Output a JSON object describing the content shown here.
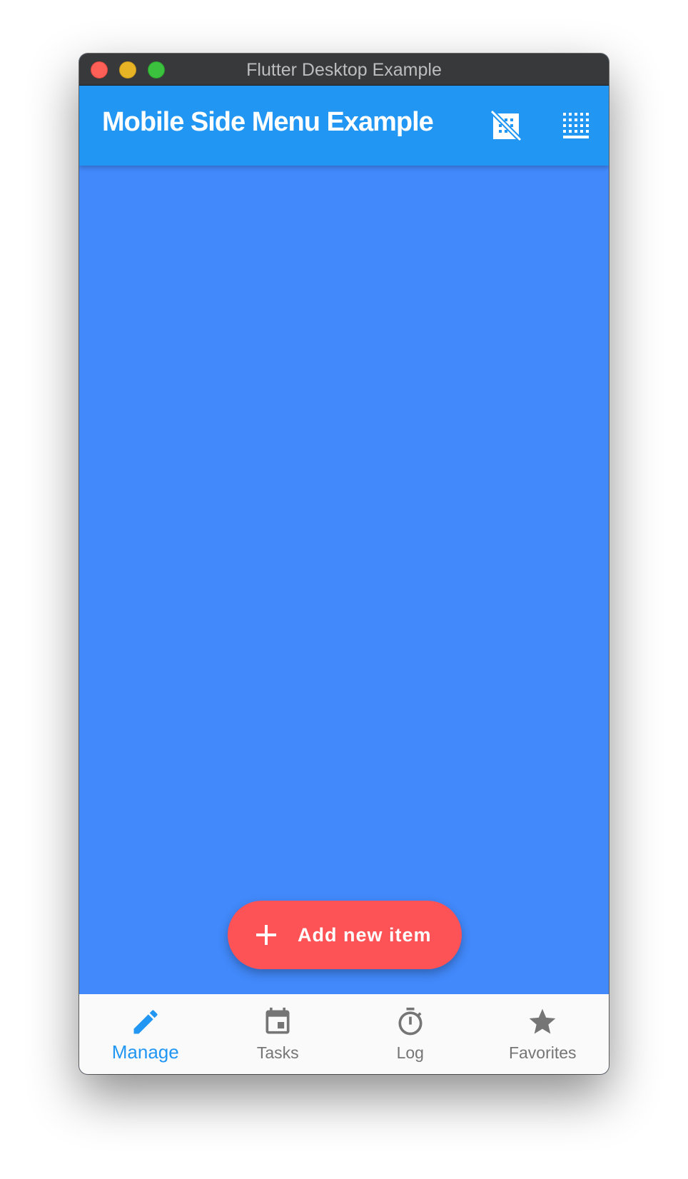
{
  "window": {
    "title": "Flutter Desktop Example"
  },
  "appbar": {
    "title": "Mobile Side Menu Example",
    "actions": [
      {
        "icon": "grid-off-icon"
      },
      {
        "icon": "grid-dots-icon"
      }
    ]
  },
  "fab": {
    "icon": "add-icon",
    "label": "Add new item"
  },
  "bottom_nav": {
    "items": [
      {
        "label": "Manage",
        "icon": "pencil-icon",
        "active": true
      },
      {
        "label": "Tasks",
        "icon": "calendar-icon",
        "active": false
      },
      {
        "label": "Log",
        "icon": "timer-icon",
        "active": false
      },
      {
        "label": "Favorites",
        "icon": "star-icon",
        "active": false
      }
    ]
  },
  "colors": {
    "appbar": "#2196f3",
    "content": "#4289fb",
    "fab": "#fd5256",
    "nav_active": "#2196f3",
    "nav_inactive": "#757575"
  }
}
